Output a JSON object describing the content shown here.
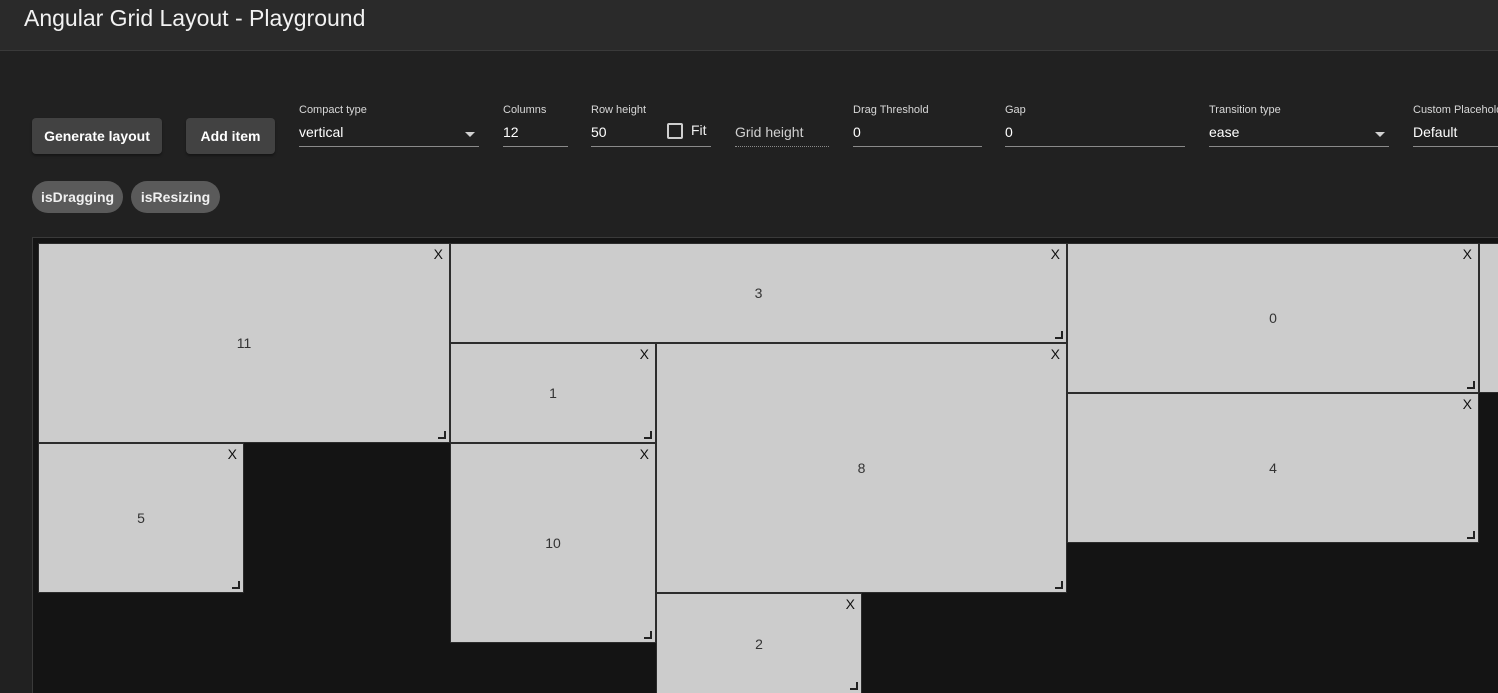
{
  "app": {
    "title": "Angular Grid Layout - Playground"
  },
  "toolbar": {
    "generate_label": "Generate layout",
    "add_label": "Add item",
    "compact_label": "Compact type",
    "compact_value": "vertical",
    "columns_label": "Columns",
    "columns_value": "12",
    "rowheight_label": "Row height",
    "rowheight_value": "50",
    "fit_label": "Fit",
    "fit_checked": false,
    "gridheight_placeholder": "Grid height",
    "drag_label": "Drag Threshold",
    "drag_value": "0",
    "gap_label": "Gap",
    "gap_value": "0",
    "transition_label": "Transition type",
    "transition_value": "ease",
    "placeholder_label": "Custom Placeholder",
    "placeholder_value": "Default"
  },
  "chips": [
    "isDragging",
    "isResizing"
  ],
  "grid": {
    "close_glyph": "X",
    "items": [
      "11",
      "3",
      "0",
      "1",
      "8",
      "5",
      "10",
      "4",
      "2",
      ""
    ]
  }
}
